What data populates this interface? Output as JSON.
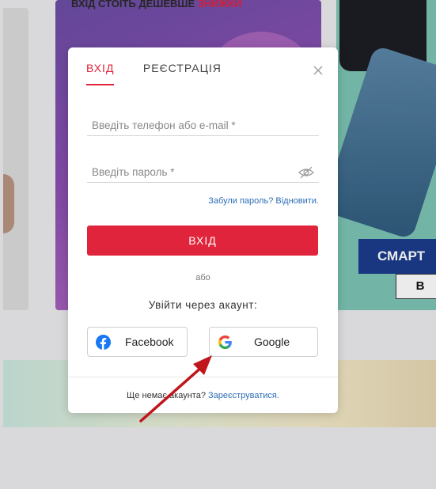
{
  "background": {
    "banner_text_dark": "ВХІД СТОЇТЬ ДЕШЕВШЕ",
    "banner_text_highlight": "ЗНИЖКИ",
    "promo_label": "СМАРТ",
    "promo_button": "В"
  },
  "modal": {
    "tabs": [
      {
        "label": "ВХІД",
        "active": true
      },
      {
        "label": "РЕЄСТРАЦІЯ",
        "active": false
      }
    ],
    "close_icon": "close-icon",
    "phone_placeholder": "Введіть телефон або e-mail *",
    "password_placeholder": "Введіть пароль *",
    "password_visibility_icon": "eye-slash-icon",
    "forgot_text": "Забули пароль? Відновити.",
    "login_button": "ВХІД",
    "or_text": "або",
    "via_account_text": "Увійти через акаунт:",
    "facebook_label": "Facebook",
    "google_label": "Google",
    "footer_text": "Ще немає акаунта?",
    "register_link": "Зареєструватися."
  },
  "colors": {
    "accent": "#e0243b",
    "link": "#2d6db5",
    "arrow": "#c0151b"
  }
}
